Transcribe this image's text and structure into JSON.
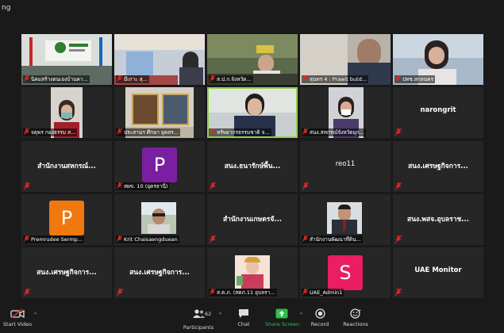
{
  "window": {
    "title": "ng"
  },
  "tiles": [
    {
      "label": "นิคมสร้างตนเองบ้านคา...",
      "kind": "video"
    },
    {
      "label": "มีเกาะ สุ...",
      "kind": "video"
    },
    {
      "label": "ส.ป.ก.จังหวัด...",
      "kind": "video"
    },
    {
      "label": "สุนทร 4 : Prawit butd...",
      "kind": "video"
    },
    {
      "label": "ปทช.สกลนคร",
      "kind": "video"
    },
    {
      "label": "จตุพร กองธรรม ส...",
      "kind": "video"
    },
    {
      "label": "ประสานฯ ศึกษา ยุคสร...",
      "kind": "video"
    },
    {
      "label": "ทรัพยากรธรรมชาติ จ...",
      "kind": "video",
      "active": true
    },
    {
      "label": "สนง.สหกรณ์จังหวัดมุก...",
      "kind": "video"
    },
    {
      "center": "narongrit",
      "kind": "name"
    },
    {
      "center": "สำนักงานสหกรณ์...",
      "kind": "name"
    },
    {
      "label": "สผข. 10 (อุดรธานี)",
      "avatar": "P",
      "avatar_color": "#7b1fa2",
      "kind": "avatar"
    },
    {
      "center": "สนง.ธนารักษ์พื้น...",
      "kind": "name"
    },
    {
      "center": "reo11",
      "kind": "name"
    },
    {
      "center": "สนง.เศรษฐกิจการ...",
      "kind": "name"
    },
    {
      "label": "Premrudee Sermp...",
      "avatar": "P",
      "avatar_color": "#f0780f",
      "kind": "avatar"
    },
    {
      "label": "Krit Chaisaengduean",
      "kind": "video"
    },
    {
      "center": "สำนักงานเกษตรจั...",
      "kind": "name"
    },
    {
      "label": "สำนักงานพัฒนาที่ดิน...",
      "kind": "video"
    },
    {
      "center": "สนง.พสจ.อุบลราช...",
      "kind": "name"
    },
    {
      "center": "สนง.เศรษฐกิจการ...",
      "kind": "name"
    },
    {
      "center": "สนง.เศรษฐกิจการ...",
      "kind": "name"
    },
    {
      "center": "",
      "kind": "name"
    },
    {
      "label": "ส.ต.ภ. (สตภ.11 อุบลรา...",
      "kind": "video"
    },
    {
      "label": "UAE_Admin1",
      "avatar": "S",
      "avatar_color": "#e91e63",
      "kind": "avatar"
    },
    {
      "center": "UAE Monitor",
      "kind": "name"
    }
  ],
  "toolbar": {
    "start_video": "Start Video",
    "participants": "Participants",
    "participants_count": "62",
    "chat": "Chat",
    "share_screen": "Share Screen",
    "record": "Record",
    "reactions": "Reactions"
  },
  "colors": {
    "share_green": "#2dc04a",
    "mic_red": "#e02828",
    "active_border": "#8fd14f"
  }
}
